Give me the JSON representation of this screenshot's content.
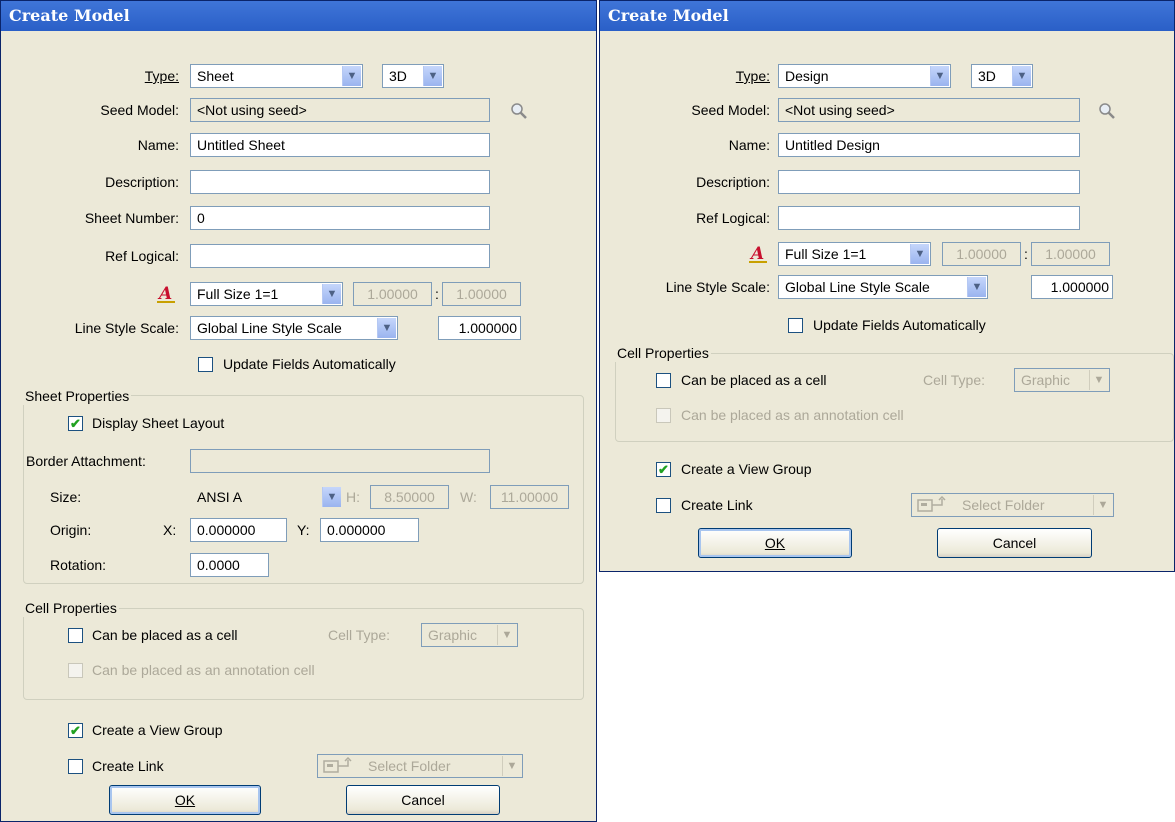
{
  "left": {
    "title": "Create Model",
    "type_label": "Type:",
    "type_value": "Sheet",
    "dim_value": "3D",
    "seed_label": "Seed Model:",
    "seed_value": "<Not using seed>",
    "name_label": "Name:",
    "name_value": "Untitled Sheet",
    "description_label": "Description:",
    "description_value": "",
    "sheet_number_label": "Sheet Number:",
    "sheet_number_value": "0",
    "ref_logical_label": "Ref Logical:",
    "ref_logical_value": "",
    "annotation_scale_value": "Full Size 1=1",
    "scale_a": "1.00000",
    "scale_b": "1.00000",
    "line_style_label": "Line Style Scale:",
    "line_style_value": "Global Line Style Scale",
    "line_style_number": "1.000000",
    "update_fields_label": "Update Fields Automatically",
    "update_fields_checked": false,
    "sheet_props": {
      "title": "Sheet Properties",
      "display_layout_label": "Display Sheet Layout",
      "display_layout_checked": true,
      "border_label": "Border Attachment:",
      "border_value": "",
      "size_label": "Size:",
      "size_value": "ANSI A",
      "h_label": "H:",
      "h_value": "8.50000",
      "w_label": "W:",
      "w_value": "11.00000",
      "origin_label": "Origin:",
      "x_label": "X:",
      "x_value": "0.000000",
      "y_label": "Y:",
      "y_value": "0.000000",
      "rotation_label": "Rotation:",
      "rotation_value": "0.0000"
    },
    "cell_props": {
      "title": "Cell Properties",
      "placed_cell_label": "Can be placed as a cell",
      "cell_type_label": "Cell Type:",
      "cell_type_value": "Graphic",
      "annotation_cell_label": "Can be placed as an annotation cell"
    },
    "view_group_label": "Create a View Group",
    "view_group_checked": true,
    "create_link_label": "Create Link",
    "select_folder_label": "Select Folder",
    "ok_label": "OK",
    "cancel_label": "Cancel"
  },
  "right": {
    "title": "Create Model",
    "type_label": "Type:",
    "type_value": "Design",
    "dim_value": "3D",
    "seed_label": "Seed Model:",
    "seed_value": "<Not using seed>",
    "name_label": "Name:",
    "name_value": "Untitled Design",
    "description_label": "Description:",
    "description_value": "",
    "ref_logical_label": "Ref Logical:",
    "ref_logical_value": "",
    "annotation_scale_value": "Full Size 1=1",
    "scale_a": "1.00000",
    "scale_b": "1.00000",
    "line_style_label": "Line Style Scale:",
    "line_style_value": "Global Line Style Scale",
    "line_style_number": "1.000000",
    "update_fields_label": "Update Fields Automatically",
    "cell_props": {
      "title": "Cell Properties",
      "placed_cell_label": "Can be placed as a cell",
      "cell_type_label": "Cell Type:",
      "cell_type_value": "Graphic",
      "annotation_cell_label": "Can be placed as an annotation cell"
    },
    "view_group_label": "Create a View Group",
    "view_group_checked": true,
    "create_link_label": "Create Link",
    "select_folder_label": "Select Folder",
    "ok_label": "OK",
    "cancel_label": "Cancel"
  },
  "icons": {
    "search": "magnifier-icon",
    "annotation_scale": "annotation-scale-icon",
    "folder": "folder-link-icon"
  }
}
